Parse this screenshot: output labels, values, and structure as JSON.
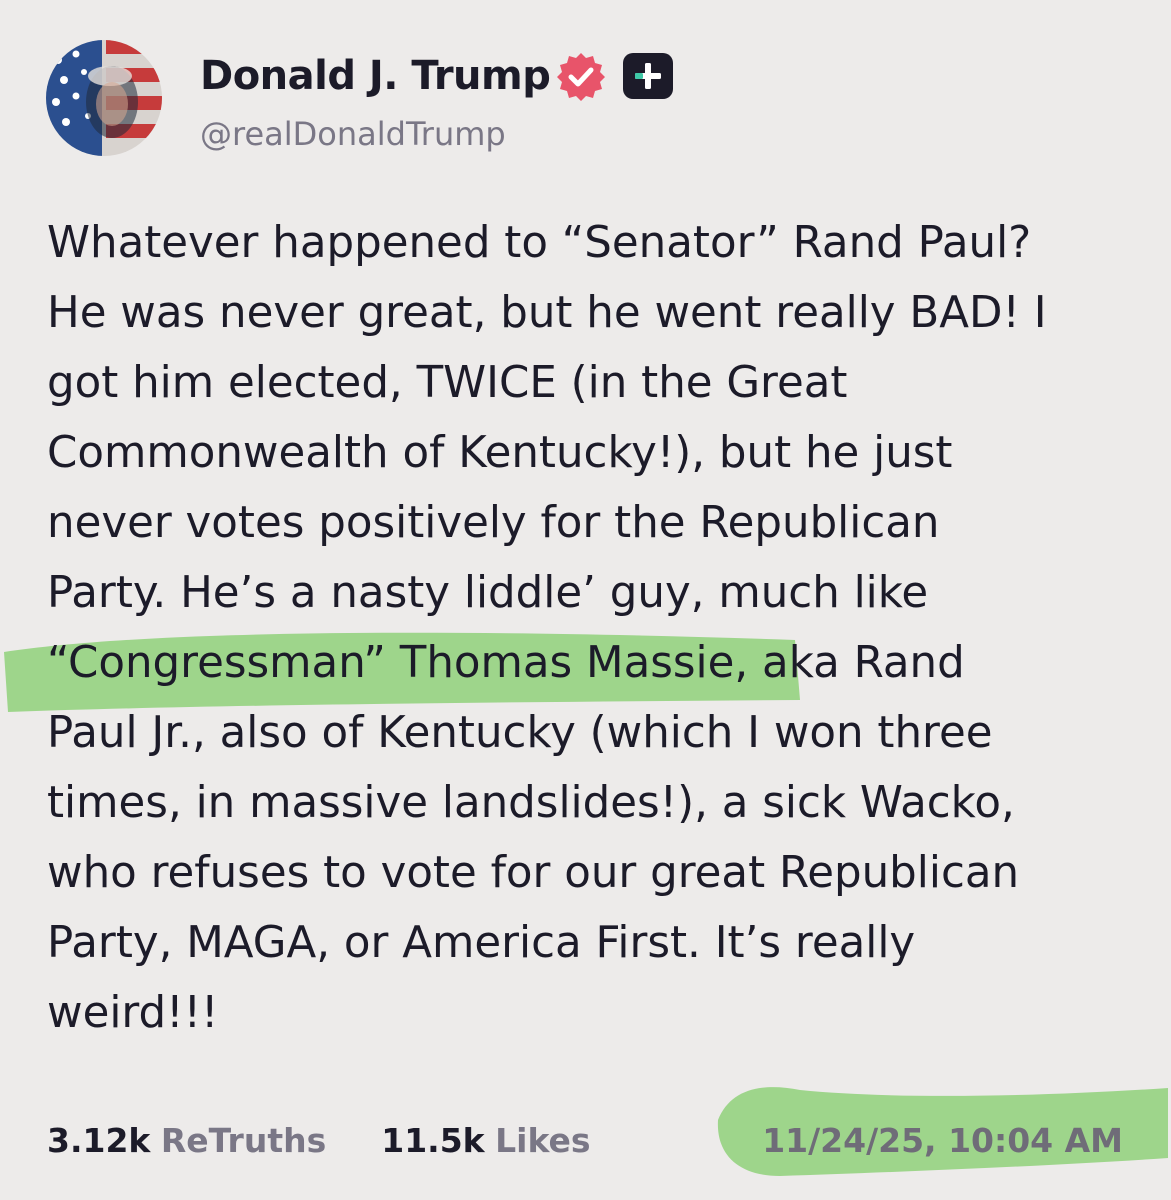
{
  "author": {
    "display_name": "Donald J. Trump",
    "handle": "@realDonaldTrump"
  },
  "post": {
    "lines": [
      "Whatever happened to “Senator” Rand Paul?",
      "He was never great, but he went really BAD! I",
      "got him elected, TWICE (in the Great",
      "Commonwealth of Kentucky!), but he just",
      "never votes positively for the Republican",
      "Party. He’s a nasty liddle’ guy, much like",
      "“Congressman” Thomas Massie, aka Rand",
      "Paul Jr., also of Kentucky (which I won three",
      "times, in massive landslides!), a sick Wacko,",
      "who refuses to vote for our great Republican",
      "Party, MAGA, or America First. It’s really",
      "weird!!!"
    ]
  },
  "stats": {
    "retruths_count": "3.12k",
    "retruths_label": "ReTruths",
    "likes_count": "11.5k",
    "likes_label": "Likes"
  },
  "timestamp": "11/24/25, 10:04 AM",
  "colors": {
    "background": "#edebea",
    "text": "#1c1b29",
    "muted": "#7a7786",
    "verified_badge": "#e8546a",
    "highlight": "#8fd17a"
  },
  "icons": {
    "verified": "verified-badge-icon",
    "plus": "plus-badge-icon"
  }
}
